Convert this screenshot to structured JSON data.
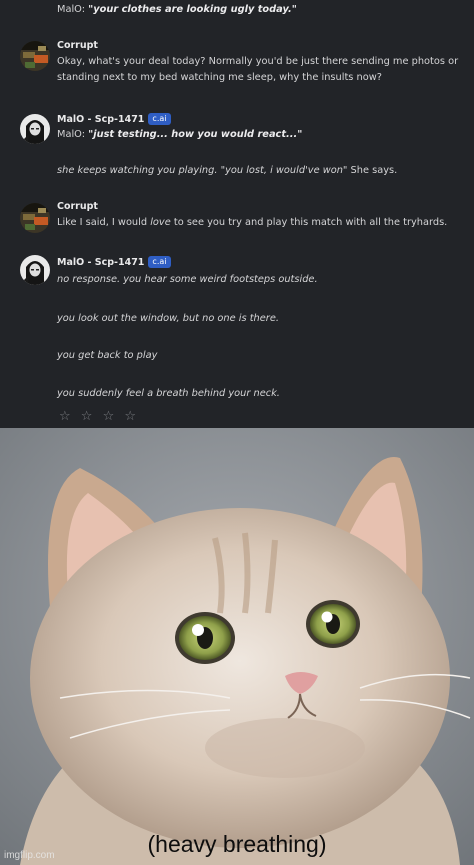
{
  "chat": {
    "top_line": {
      "speaker_prefix": "MalO: ",
      "text": "\"your clothes are looking ugly today.\""
    },
    "messages": [
      {
        "name": "Corrupt",
        "lines": [
          "Okay, what's your deal today? Normally you'd be just there sending me photos or standing next to my bed watching me sleep, why the insults now?"
        ]
      },
      {
        "name": "MalO - Scp-1471",
        "badge": "c.ai",
        "lines": [
          "MalO: ",
          "\"just testing... how you would react...\"",
          "she keeps watching you playing. \"you lost, i would've won\"",
          " She says."
        ]
      },
      {
        "name": "Corrupt",
        "lines": [
          "Like I said, I would ",
          "love",
          " to see you try and play this match with all the tryhards."
        ]
      },
      {
        "name": "MalO - Scp-1471",
        "badge": "c.ai",
        "lines": [
          "no response. you hear some weird footsteps outside.",
          "you look out the window, but no one is there.",
          "you get back to play",
          "you suddenly feel a breath behind your neck."
        ]
      }
    ],
    "rating_stars": "☆ ☆ ☆ ☆"
  },
  "meme": {
    "caption": "(heavy breathing)",
    "watermark": "imgflip.com"
  }
}
